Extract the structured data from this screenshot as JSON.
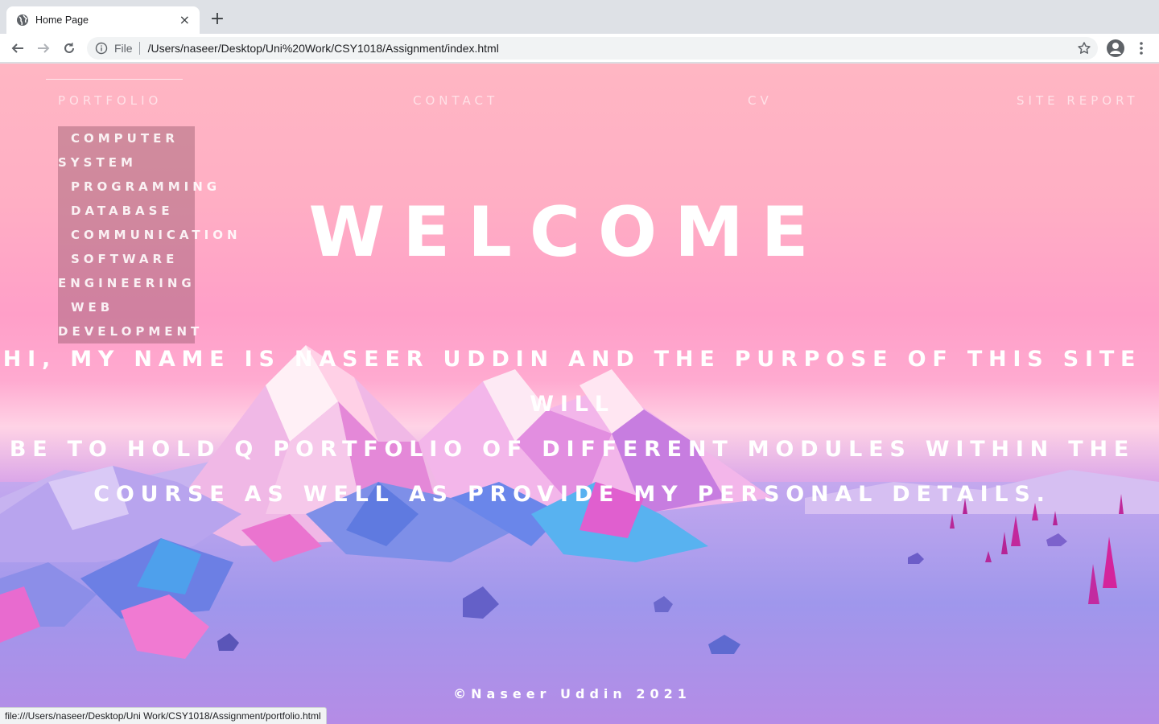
{
  "browser": {
    "tab": {
      "title": "Home Page",
      "favicon": "globe-icon",
      "close": "×"
    },
    "new_tab": "+",
    "omnibox": {
      "scheme": "File",
      "url": "/Users/naseer/Desktop/Uni%20Work/CSY1018/Assignment/index.html"
    },
    "status_url": "file:///Users/naseer/Desktop/Uni Work/CSY1018/Assignment/portfolio.html"
  },
  "nav": {
    "portfolio": "PORTFOLIO",
    "contact": "CONTACT",
    "cv": "CV",
    "site_report": "SITE REPORT"
  },
  "dropdown": {
    "computer_system_a": "COMPUTER",
    "computer_system_b": "SYSTEM",
    "programming": "PROGRAMMING",
    "database": "DATABASE",
    "communication": "COMMUNICATION",
    "software_eng_a": "SOFTWARE",
    "software_eng_b": "ENGINEERING",
    "web_dev_a": "WEB",
    "web_dev_b": "DEVELOPMENT"
  },
  "hero": {
    "heading": "WELCOME",
    "intro_line1": "HI, MY NAME IS NASEER UDDIN AND THE PURPOSE OF THIS SITE WILL",
    "intro_line2": "BE TO HOLD Q PORTFOLIO OF DIFFERENT MODULES WITHIN THE",
    "intro_line3": "COURSE AS WELL AS PROVIDE MY PERSONAL DETAILS."
  },
  "footer": {
    "copyright": "©Naseer Uddin 2021"
  },
  "colors": {
    "sky_top": "#ffb6c3",
    "ground": "#9b93ea",
    "text": "#ffffff"
  }
}
